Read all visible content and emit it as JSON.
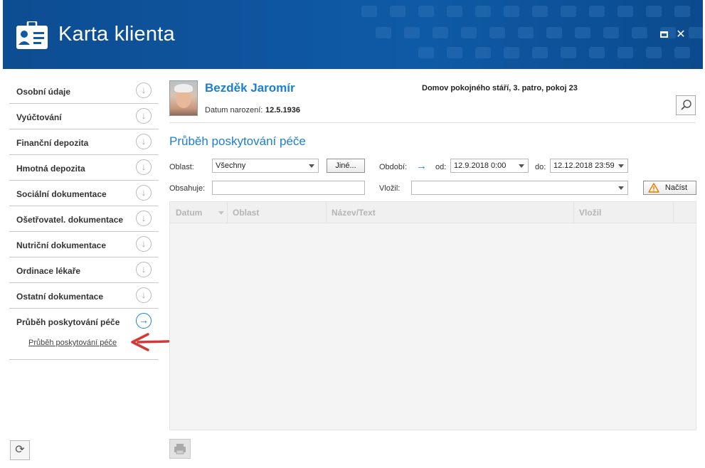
{
  "window": {
    "title": "Karta klienta"
  },
  "sidebar": {
    "items": [
      {
        "label": "Osobní údaje"
      },
      {
        "label": "Vyúčtování"
      },
      {
        "label": "Finanční depozita"
      },
      {
        "label": "Hmotná depozita"
      },
      {
        "label": "Sociální dokumentace"
      },
      {
        "label": "Ošetřovatel. dokumentace"
      },
      {
        "label": "Nutriční dokumentace"
      },
      {
        "label": "Ordinace lékaře"
      },
      {
        "label": "Ostatní dokumentace"
      },
      {
        "label": "Průběh poskytování péče"
      }
    ],
    "subitem": "Průběh poskytování péče"
  },
  "client": {
    "name": "Bezděk Jaromír",
    "dob_label": "Datum narození:",
    "dob": "12.5.1936",
    "location": "Domov pokojného stáří, 3. patro, pokoj 23"
  },
  "section": {
    "title": "Průběh poskytování péče"
  },
  "filters": {
    "oblast_label": "Oblast:",
    "oblast_value": "Všechny",
    "jine_label": "Jiné...",
    "obdobi_label": "Období:",
    "od_label": "od:",
    "od_value": "12.9.2018 0:00",
    "do_label": "do:",
    "do_value": "12.12.2018 23:59",
    "obsahuje_label": "Obsahuje:",
    "obsahuje_value": "",
    "vlozil_label": "Vložil:",
    "vlozil_value": "",
    "nacist_label": "Načíst"
  },
  "grid": {
    "columns": [
      "Datum",
      "Oblast",
      "Název/Text",
      "Vložil"
    ],
    "rows": []
  },
  "colors": {
    "accent": "#1a7fd4",
    "titlebar": "#0f5aa6",
    "warning": "#e07b00",
    "arrow": "#d23a3a"
  }
}
